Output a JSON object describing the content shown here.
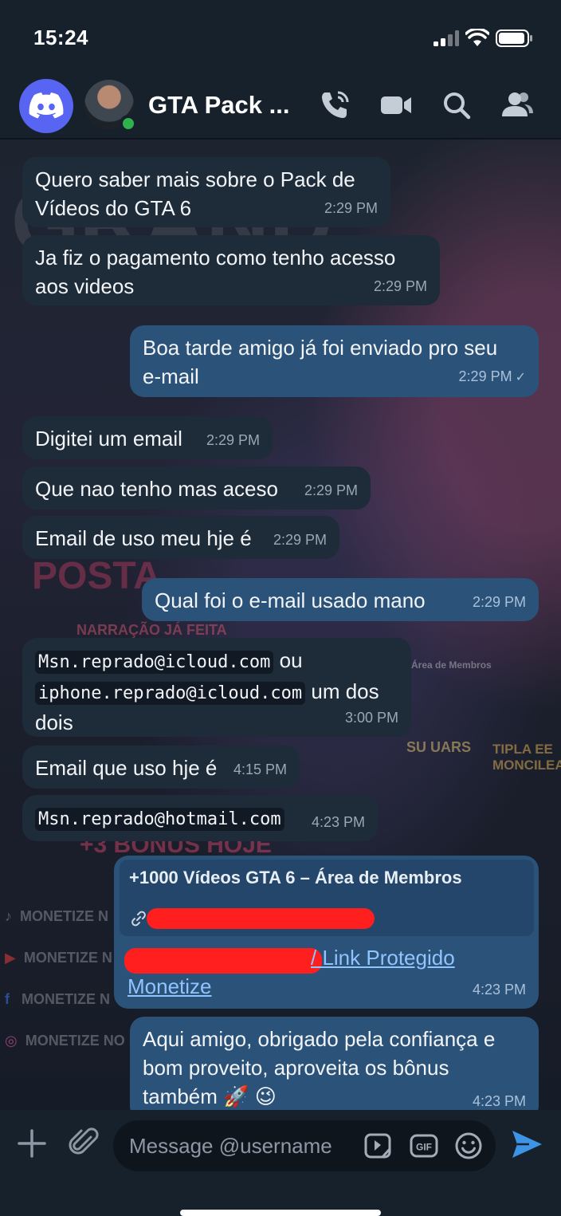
{
  "status_bar": {
    "time": "15:24"
  },
  "header": {
    "title": "GTA Pack ...",
    "icons": [
      "discord-icon",
      "avatar",
      "phone-icon",
      "video-icon",
      "search-icon",
      "members-icon"
    ]
  },
  "messages": [
    {
      "dir": "in",
      "line1": "Quero saber mais sobre o Pack de",
      "line2": "Vídeos do GTA 6",
      "time": "2:29 PM"
    },
    {
      "dir": "in",
      "line1": "Ja fiz o pagamento como tenho acesso",
      "line2": "aos videos",
      "time": "2:29 PM"
    },
    {
      "dir": "out",
      "line1": "Boa tarde amigo já foi enviado pro seu",
      "line2": "e-mail",
      "time": "2:29 PM",
      "status": "✓"
    },
    {
      "dir": "in",
      "line1": "Digitei um email",
      "time": "2:29 PM"
    },
    {
      "dir": "in",
      "line1": "Que nao tenho mas aceso",
      "time": "2:29 PM"
    },
    {
      "dir": "in",
      "line1": "Email de uso meu hje é",
      "time": "2:29 PM"
    },
    {
      "dir": "out",
      "line1": "Qual foi o e-mail usado mano",
      "time": "2:29 PM"
    },
    {
      "dir": "in",
      "email1": "Msn.reprado@icloud.com",
      "mid": "ou",
      "email2": "iphone.reprado@icloud.com",
      "tail1": "um dos",
      "tail2": "dois",
      "time": "3:00 PM"
    },
    {
      "dir": "in",
      "line1": "Email que uso hje é",
      "time": "4:15 PM"
    },
    {
      "dir": "in",
      "email1": "Msn.reprado@hotmail.com",
      "time": "4:23 PM"
    },
    {
      "dir": "out",
      "card_title": "+1000 Vídeos GTA 6 – Área de Membros",
      "link1": "/ Link Protegido",
      "link2": "Monetize",
      "time": "4:23 PM"
    },
    {
      "dir": "out",
      "line1": "Aqui amigo, obrigado pela confiança e",
      "line2": "bom proveito, aproveita os bônus",
      "line3": "também 🚀 😉",
      "time": "4:23 PM"
    }
  ],
  "background": {
    "words": [
      "NARRAÇÃO JÁ FEITA",
      "POSTA",
      "+3 BÔNUS HOJE",
      "SU UARS",
      "TIPLA EE MONCILEA",
      "Área de Membros"
    ],
    "social": [
      "MONETIZE N",
      "MONETIZE N",
      "MONETIZE N",
      "MONETIZE NO IN"
    ]
  },
  "composer": {
    "placeholder": "Message @username",
    "value": ""
  }
}
